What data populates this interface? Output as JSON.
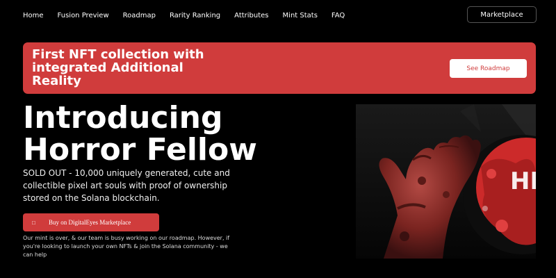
{
  "nav": {
    "items": [
      "Home",
      "Fusion Preview",
      "Roadmap",
      "Rarity Ranking",
      "Attributes",
      "Mint Stats",
      "FAQ"
    ],
    "marketplace_label": "Marketplace"
  },
  "banner": {
    "title": "First NFT collection with integrated Additional Reality",
    "button_label": "See Roadmap",
    "color": "#d03c3c"
  },
  "hero": {
    "title": "Introducing Horror Fellow",
    "description": "SOLD OUT - 10,000 uniquely generated, cute and collectible pixel art souls with proof of ownership stored on the Solana blockchain.",
    "buy_button": {
      "icon": "square-icon",
      "label": "Buy on DigitalEyes Marketplace"
    },
    "note": "Our mint is over, & our team is busy working on our roadmap. However, if you're looking to launch your own NFTs & join the Solana community - we can help"
  },
  "art": {
    "logo_text": "HF"
  }
}
